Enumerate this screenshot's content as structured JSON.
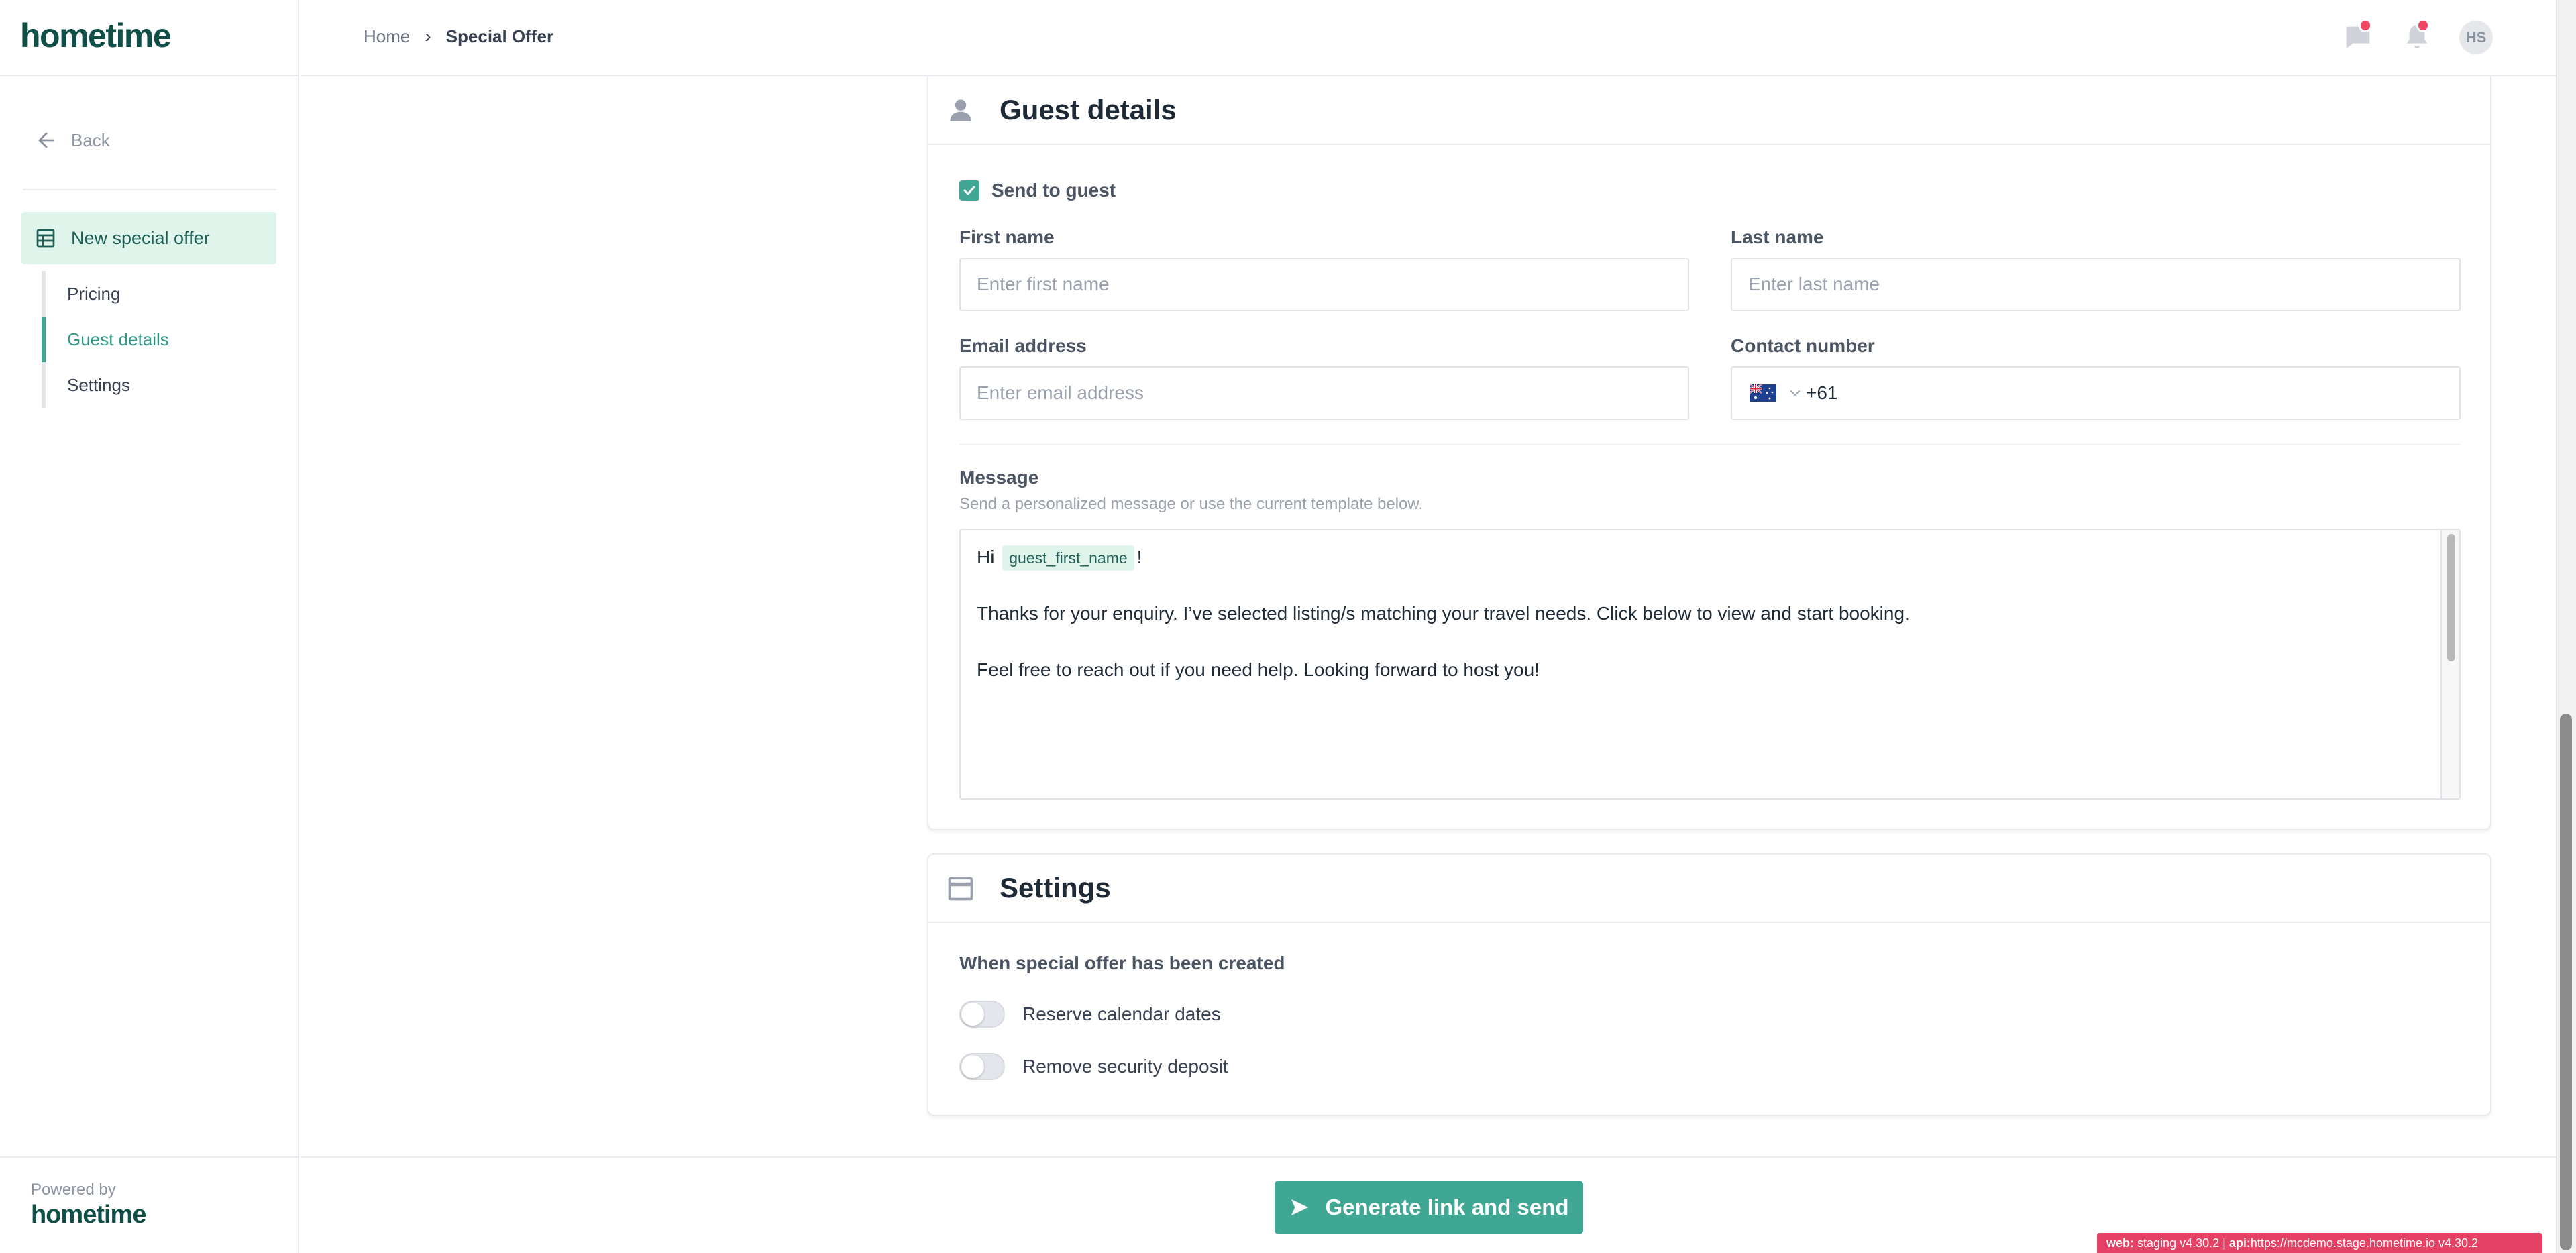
{
  "brand": {
    "logo": "hometime",
    "powered_by": "Powered by",
    "powered_logo": "hometime",
    "accent": "#40a794",
    "accent_light": "#dff5ec",
    "dark": "#0f4f48"
  },
  "sidebar": {
    "back_label": "Back",
    "active_item": "New special offer",
    "subitems": [
      {
        "label": "Pricing",
        "active": false
      },
      {
        "label": "Guest details",
        "active": true
      },
      {
        "label": "Settings",
        "active": false
      }
    ]
  },
  "header": {
    "breadcrumb": {
      "home": "Home",
      "separator": "›",
      "current": "Special Offer"
    },
    "avatar_initials": "HS",
    "icons": [
      "chat-icon",
      "bell-icon"
    ]
  },
  "guest_details": {
    "title": "Guest details",
    "send_to_guest": {
      "label": "Send to guest",
      "checked": true
    },
    "first_name": {
      "label": "First name",
      "placeholder": "Enter first name",
      "value": ""
    },
    "last_name": {
      "label": "Last name",
      "placeholder": "Enter last name",
      "value": ""
    },
    "email": {
      "label": "Email address",
      "placeholder": "Enter email address",
      "value": ""
    },
    "contact": {
      "label": "Contact number",
      "country": "AU",
      "value": "+61"
    },
    "message": {
      "label": "Message",
      "help": "Send a personalized message or use the current template below.",
      "greeting_prefix": "Hi",
      "tag": "guest_first_name",
      "greeting_suffix": "!",
      "line2": "Thanks for your enquiry. I’ve selected listing/s matching your travel needs. Click below to view and start booking.",
      "line3": "Feel free to reach out if you need help. Looking forward to host you!"
    }
  },
  "settings": {
    "title": "Settings",
    "subtitle": "When special offer has been created",
    "toggles": [
      {
        "label": "Reserve calendar dates",
        "on": false
      },
      {
        "label": "Remove security deposit",
        "on": false
      }
    ]
  },
  "footer": {
    "primary_button": "Generate link and send"
  },
  "env_badge": {
    "web_label": "web:",
    "web_value": "staging v4.30.2",
    "sep": "|",
    "api_label": "api:",
    "api_value": "https://mcdemo.stage.hometime.io v4.30.2"
  }
}
